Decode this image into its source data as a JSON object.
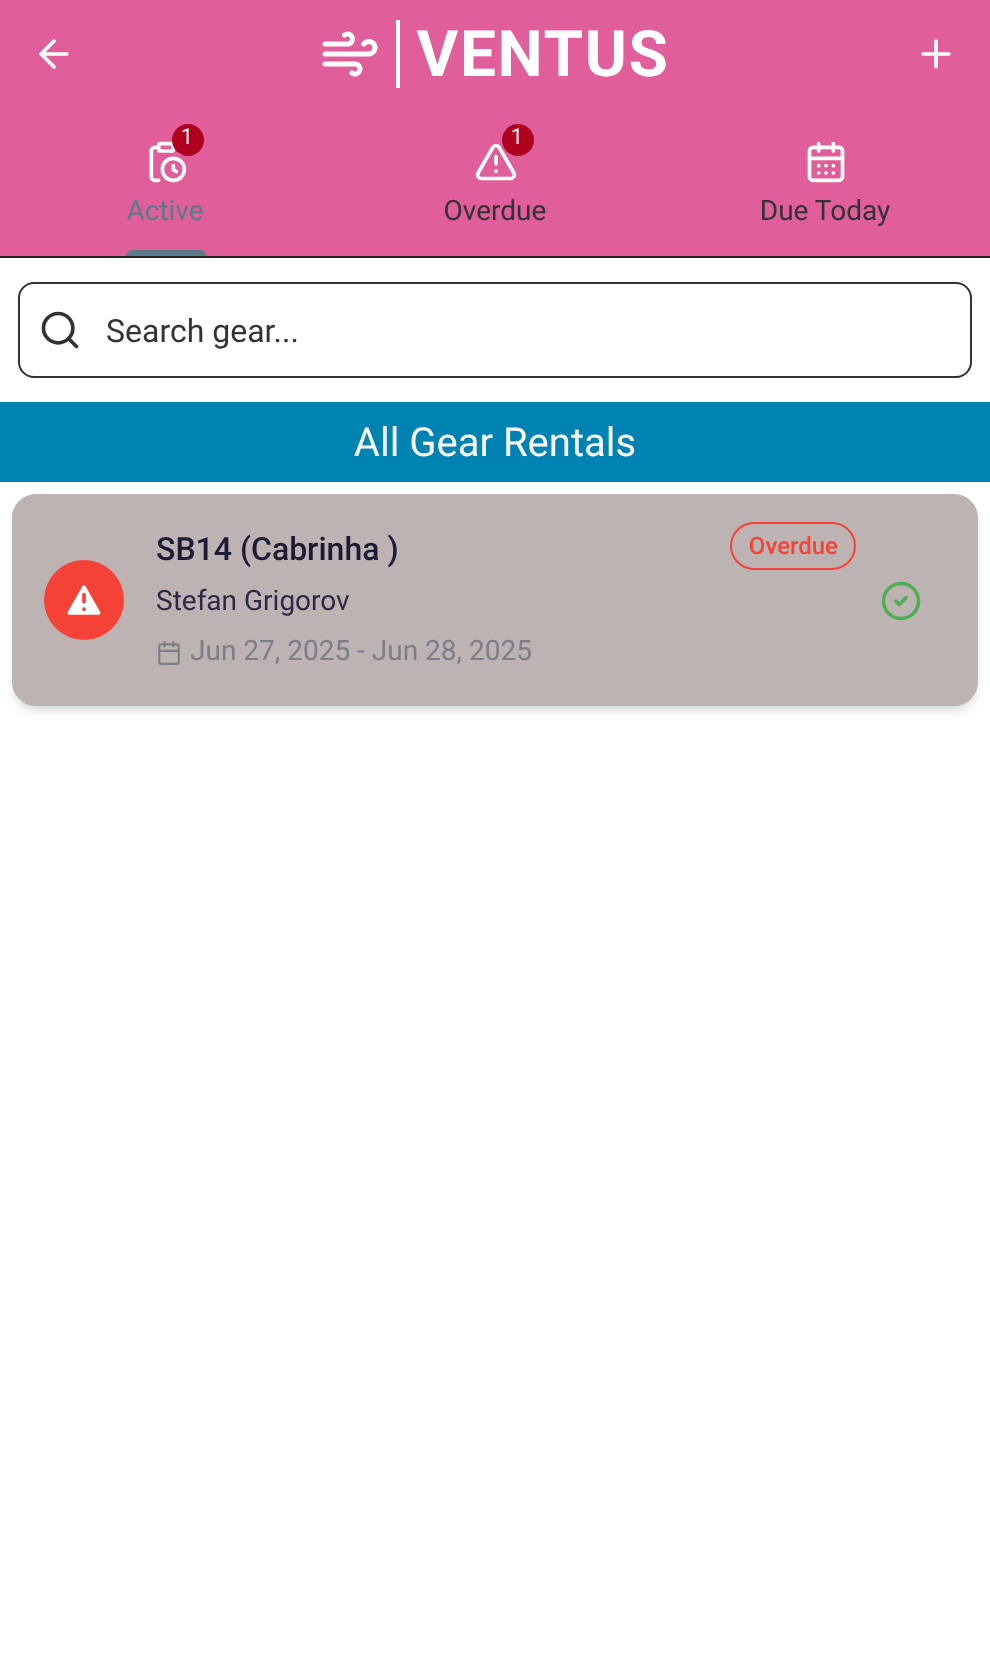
{
  "app_bar": {
    "brand": "VENTUS"
  },
  "tabs": [
    {
      "kind": "active",
      "label": "Active",
      "badge": "1",
      "selected": true
    },
    {
      "kind": "overdue",
      "label": "Overdue",
      "badge": "1",
      "selected": false
    },
    {
      "kind": "today",
      "label": "Due Today",
      "selected": false
    }
  ],
  "search": {
    "placeholder": "Search gear..."
  },
  "section_title": "All Gear Rentals",
  "rentals": [
    {
      "kind": "overdue",
      "title": "SB14 (Cabrinha )",
      "customer": "Stefan Grigorov",
      "dates": "Jun 27, 2025 - Jun 28, 2025",
      "status": "Overdue"
    }
  ]
}
